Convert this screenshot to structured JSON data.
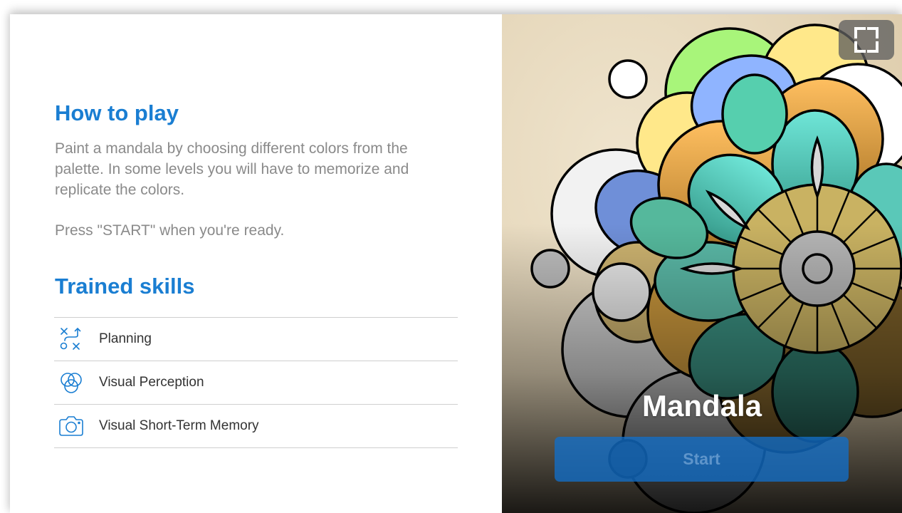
{
  "instructions": {
    "how_to_play_title": "How to play",
    "description": "Paint a mandala by choosing different colors from the palette. In some levels you will have to memorize and replicate the colors.",
    "press_text": "Press \"START\" when you're ready."
  },
  "skills": {
    "title": "Trained skills",
    "items": [
      {
        "label": "Planning",
        "icon": "planning-icon"
      },
      {
        "label": "Visual Perception",
        "icon": "visual-perception-icon"
      },
      {
        "label": "Visual Short-Term Memory",
        "icon": "camera-icon"
      }
    ]
  },
  "game": {
    "title": "Mandala",
    "start_label": "Start",
    "fullscreen_icon": "fullscreen-icon"
  },
  "colors": {
    "accent": "#1a7ed2",
    "start_button": "#126ec8",
    "text_muted": "#8a8a8a"
  }
}
